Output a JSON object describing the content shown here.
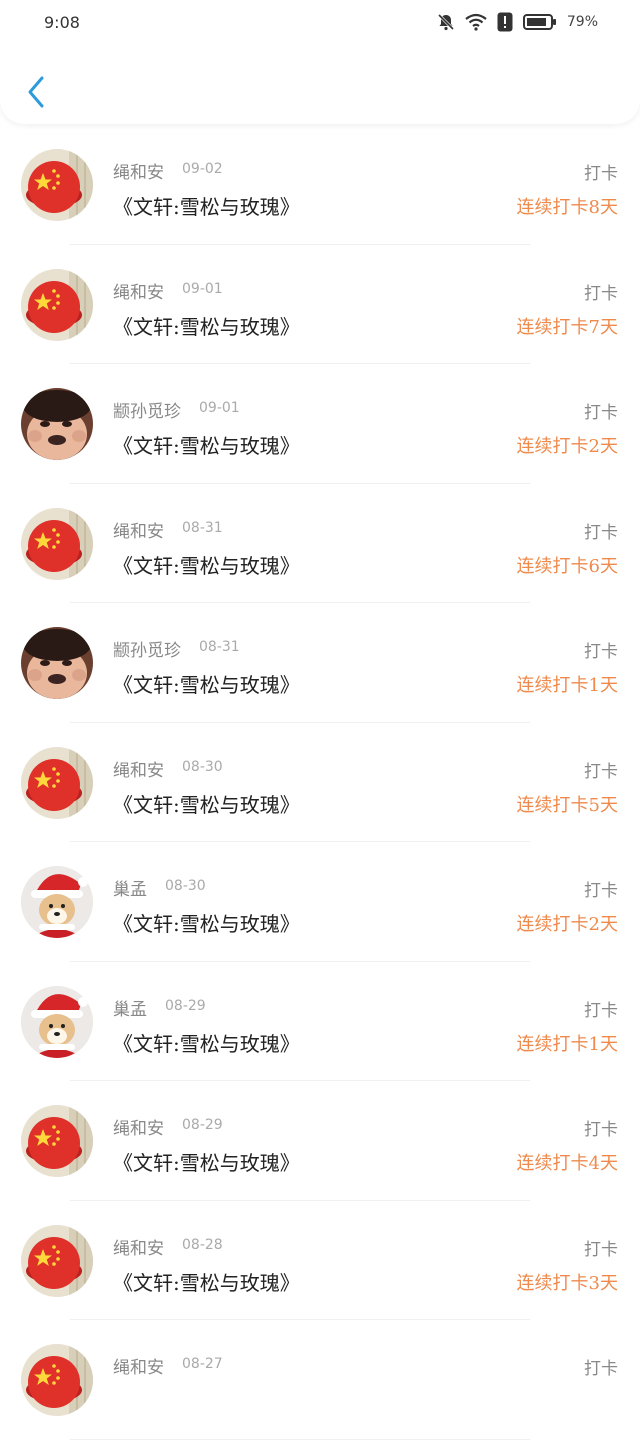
{
  "status_bar": {
    "time": "9:08",
    "battery_percent": "79%",
    "icons": [
      "mute-bell-icon",
      "wifi-icon",
      "alert-icon",
      "battery-icon"
    ]
  },
  "header": {
    "back_icon": "chevron-left-icon",
    "accent": "#2d9cdb"
  },
  "colors": {
    "streak": "#ef8a4c",
    "name": "#888888",
    "date": "#aaaaaa",
    "title": "#222222"
  },
  "items": [
    {
      "name": "绳和安",
      "date": "09-02",
      "title": "《文轩:雪松与玫瑰》",
      "type": "打卡",
      "streak": "连续打卡8天",
      "avatar": "flag"
    },
    {
      "name": "绳和安",
      "date": "09-01",
      "title": "《文轩:雪松与玫瑰》",
      "type": "打卡",
      "streak": "连续打卡7天",
      "avatar": "flag"
    },
    {
      "name": "颛孙觅珍",
      "date": "09-01",
      "title": "《文轩:雪松与玫瑰》",
      "type": "打卡",
      "streak": "连续打卡2天",
      "avatar": "face"
    },
    {
      "name": "绳和安",
      "date": "08-31",
      "title": "《文轩:雪松与玫瑰》",
      "type": "打卡",
      "streak": "连续打卡6天",
      "avatar": "flag"
    },
    {
      "name": "颛孙觅珍",
      "date": "08-31",
      "title": "《文轩:雪松与玫瑰》",
      "type": "打卡",
      "streak": "连续打卡1天",
      "avatar": "face"
    },
    {
      "name": "绳和安",
      "date": "08-30",
      "title": "《文轩:雪松与玫瑰》",
      "type": "打卡",
      "streak": "连续打卡5天",
      "avatar": "flag"
    },
    {
      "name": "巢孟",
      "date": "08-30",
      "title": "《文轩:雪松与玫瑰》",
      "type": "打卡",
      "streak": "连续打卡2天",
      "avatar": "dog"
    },
    {
      "name": "巢孟",
      "date": "08-29",
      "title": "《文轩:雪松与玫瑰》",
      "type": "打卡",
      "streak": "连续打卡1天",
      "avatar": "dog"
    },
    {
      "name": "绳和安",
      "date": "08-29",
      "title": "《文轩:雪松与玫瑰》",
      "type": "打卡",
      "streak": "连续打卡4天",
      "avatar": "flag"
    },
    {
      "name": "绳和安",
      "date": "08-28",
      "title": "《文轩:雪松与玫瑰》",
      "type": "打卡",
      "streak": "连续打卡3天",
      "avatar": "flag"
    },
    {
      "name": "绳和安",
      "date": "08-27",
      "title": "",
      "type": "打卡",
      "streak": "",
      "avatar": "flag"
    }
  ]
}
